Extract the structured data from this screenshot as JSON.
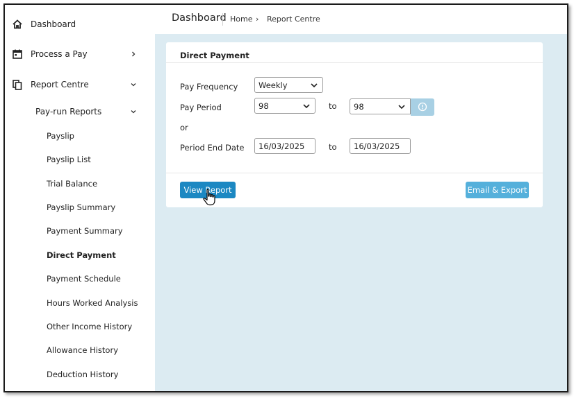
{
  "sidebar": {
    "dashboard": "Dashboard",
    "process_a_pay": "Process a Pay",
    "report_centre": "Report Centre",
    "pay_run_reports": "Pay-run Reports",
    "reports": [
      "Payslip",
      "Payslip List",
      "Trial Balance",
      "Payslip Summary",
      "Payment Summary",
      "Direct Payment",
      "Payment Schedule",
      "Hours Worked Analysis",
      "Other Income History",
      "Allowance History",
      "Deduction History"
    ],
    "active_report": "Direct Payment"
  },
  "header": {
    "title": "Dashboard",
    "breadcrumb": [
      "Home",
      "Report Centre"
    ],
    "breadcrumb_separator": "›"
  },
  "card": {
    "title": "Direct Payment",
    "pay_frequency_label": "Pay Frequency",
    "pay_frequency_value": "Weekly",
    "pay_period_label": "Pay Period",
    "pay_period_from": "98",
    "pay_period_to": "98",
    "to_label": "to",
    "or_label": "or",
    "period_end_date_label": "Period End Date",
    "period_end_from": "16/03/2025",
    "period_end_to": "16/03/2025",
    "view_report_label": "View Report",
    "email_export_label": "Email & Export"
  },
  "colors": {
    "main_background": "#dcebf2",
    "primary_button": "#1c88c2",
    "secondary_button": "#55b0db",
    "info_button": "#a8d0e4"
  }
}
